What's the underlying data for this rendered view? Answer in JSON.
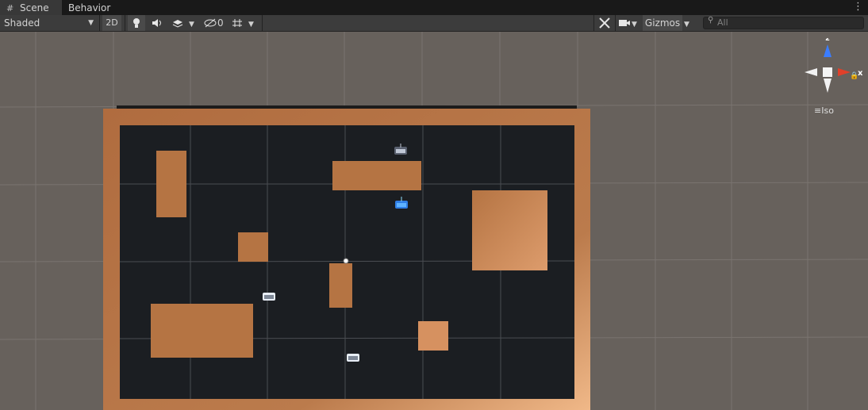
{
  "tabs": {
    "scene": "Scene",
    "behavior_designer": "Behavior Designer",
    "menu": "⋮"
  },
  "toolbar": {
    "shading_mode": "Shaded",
    "mode_2d": "2D",
    "hidden_count": "0",
    "gizmos": "Gizmos",
    "search_placeholder": "All"
  },
  "gizmo": {
    "x_label": "x",
    "z_label": "z",
    "projection": "Iso"
  },
  "colors": {
    "scene_bg": "#67615c",
    "floor": "#1b1e22",
    "wall": "#b8784a",
    "blue_agent": "#3aa0ff",
    "x_axis": "#e0402a",
    "z_axis": "#3b7dff"
  },
  "scene_objects": [
    "arena-floor",
    "arena-walls",
    "obstacle-blocks",
    "agent-icons"
  ]
}
